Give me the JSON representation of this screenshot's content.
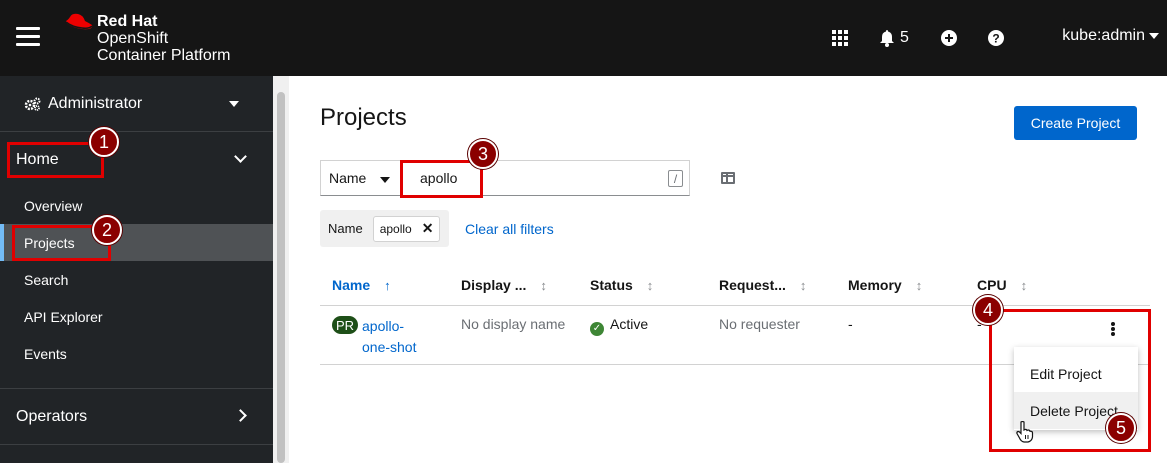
{
  "masthead": {
    "brand_line1": "Red Hat",
    "brand_line2": "OpenShift",
    "brand_line3": "Container Platform",
    "notifications_count": "5",
    "user": "kube:admin",
    "icons": [
      "hamburger-icon",
      "red-hat-logo-icon",
      "app-launcher-icon",
      "bell-icon",
      "plus-circle-icon",
      "help-icon",
      "caret-down-icon"
    ]
  },
  "sidebar": {
    "perspective": "Administrator",
    "home_section": "Home",
    "items": [
      {
        "label": "Overview",
        "active": false
      },
      {
        "label": "Projects",
        "active": true
      },
      {
        "label": "Search",
        "active": false
      },
      {
        "label": "API Explorer",
        "active": false
      },
      {
        "label": "Events",
        "active": false
      }
    ],
    "operators_section": "Operators"
  },
  "main": {
    "title": "Projects",
    "create_button": "Create Project",
    "filter": {
      "type": "Name",
      "value": "apollo",
      "shortcut": "/"
    },
    "chip_group": {
      "category": "Name",
      "chip": "apollo",
      "remove": "✕"
    },
    "clear_filters": "Clear all filters",
    "table": {
      "headers": [
        "Name",
        "Display ...",
        "Status",
        "Request...",
        "Memory",
        "CPU"
      ],
      "rows": [
        {
          "badge": "PR",
          "name_line1": "apollo-",
          "name_line2": "one-shot",
          "display_name": "No display name",
          "status": "Active",
          "requester": "No requester",
          "memory": "-",
          "cpu": "-"
        }
      ]
    },
    "kebab_menu": [
      "Edit Project",
      "Delete Project"
    ]
  },
  "callouts": [
    "1",
    "2",
    "3",
    "4",
    "5"
  ],
  "colors": {
    "masthead": "#151515",
    "sidebar": "#212427",
    "primary": "#0066cc",
    "callout": "#e00000",
    "callout_badge": "#8b0000",
    "active_status": "#3e8635"
  }
}
